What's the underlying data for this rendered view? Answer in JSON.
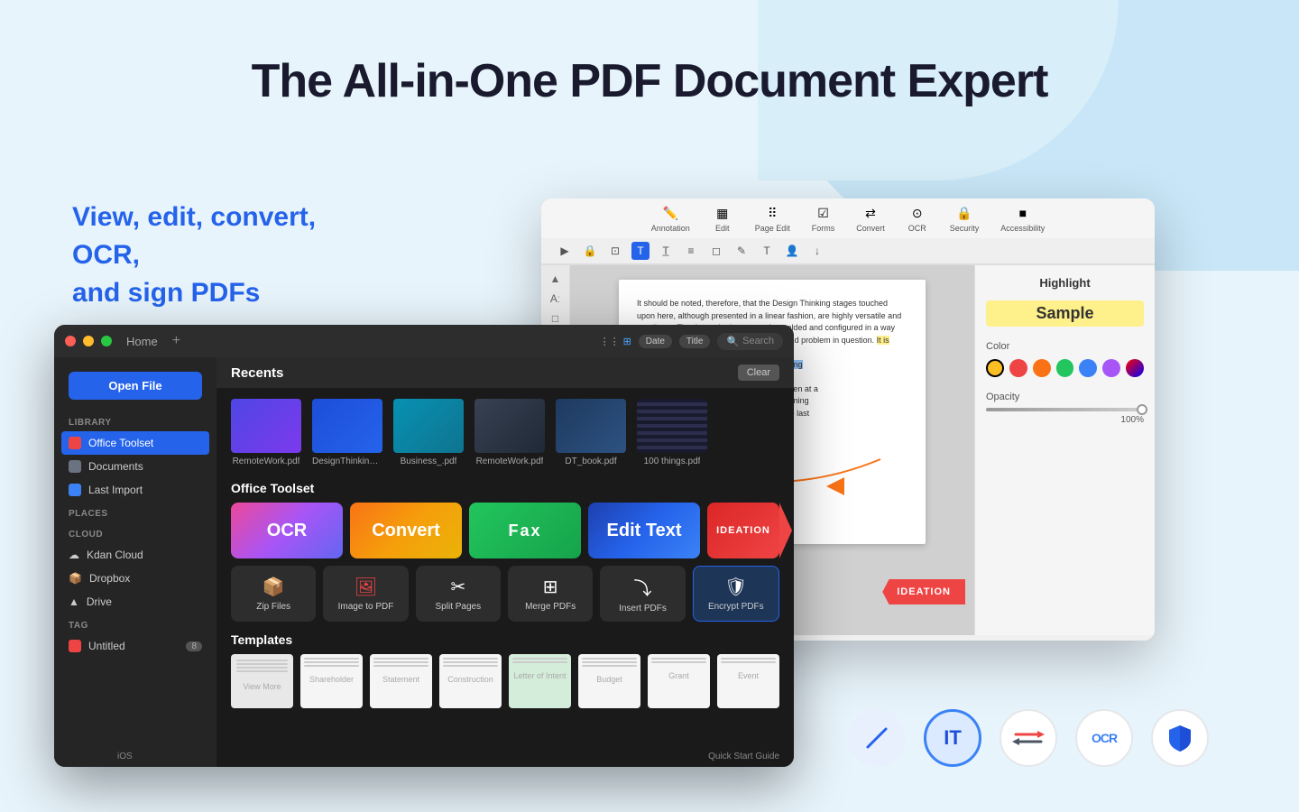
{
  "page": {
    "title": "The All-in-One PDF Document Expert",
    "subtitle": "View, edit, convert, OCR,\nand sign PDFs",
    "bg_color": "#e8f4fb"
  },
  "mac_window": {
    "title": "Home",
    "recents_label": "Recents",
    "clear_label": "Clear",
    "library_label": "LIBRARY",
    "places_label": "PLACES",
    "cloud_label": "CLOUD",
    "tag_label": "TAG",
    "open_file_label": "Open File",
    "sidebar_items": [
      {
        "label": "Office Toolset",
        "active": true
      },
      {
        "label": "Documents",
        "active": false
      },
      {
        "label": "Last Import",
        "active": false
      }
    ],
    "cloud_items": [
      {
        "label": "Kdan Cloud"
      },
      {
        "label": "Dropbox"
      },
      {
        "label": "Drive"
      }
    ],
    "tag_items": [
      {
        "label": "Untitled"
      }
    ],
    "recent_files": [
      {
        "name": "RemoteWork.pdf"
      },
      {
        "name": "DesignThinking.pdf"
      },
      {
        "name": "Business_.pdf"
      },
      {
        "name": "RemoteWork.pdf"
      },
      {
        "name": "DT_book.pdf"
      },
      {
        "name": "100 things.pdf"
      }
    ],
    "section_label": "Office Toolset",
    "feature_tiles": [
      {
        "label": "OCR",
        "style": "ocr"
      },
      {
        "label": "Convert",
        "style": "convert"
      },
      {
        "label": "Fax",
        "style": "fax"
      },
      {
        "label": "Edit Text",
        "style": "edittext"
      }
    ],
    "ideation_label": "IDEATION",
    "tools": [
      {
        "label": "Zip Files",
        "icon": "📦"
      },
      {
        "label": "Image to PDF",
        "icon": "🖼"
      },
      {
        "label": "Split Pages",
        "icon": "✂"
      },
      {
        "label": "Merge PDFs",
        "icon": "⊞"
      },
      {
        "label": "Insert PDFs",
        "icon": "⤵"
      },
      {
        "label": "Encrypt PDFs",
        "icon": "🛡"
      }
    ],
    "templates_label": "Templates",
    "template_items": [
      {
        "label": "View More"
      },
      {
        "label": "Shareholder"
      },
      {
        "label": "Statement"
      },
      {
        "label": "Construction"
      },
      {
        "label": "Letter of Intent"
      },
      {
        "label": "Budget"
      },
      {
        "label": "Grant"
      },
      {
        "label": "Event"
      }
    ],
    "ios_label": "iOS",
    "quick_start_label": "Quick Start Guide"
  },
  "pdf_window": {
    "toolbar_groups": [
      {
        "label": "Annotation",
        "icon": "✏"
      },
      {
        "label": "Edit",
        "icon": "▦"
      },
      {
        "label": "Page Edit",
        "icon": "⠿"
      },
      {
        "label": "Forms",
        "icon": "☑"
      },
      {
        "label": "Convert",
        "icon": "⇄"
      },
      {
        "label": "OCR",
        "icon": "⊙"
      },
      {
        "label": "Security",
        "icon": "🔒"
      },
      {
        "label": "Accessibility",
        "icon": "■"
      }
    ],
    "sub_tools": [
      "▶",
      "🔒",
      "⊡",
      "T",
      "T̲",
      "≡",
      "□",
      "✎",
      "T",
      "👤",
      "↓"
    ],
    "page_text": "It should be noted, therefore, that the Design Thinking stages touched upon here, although presented in a linear fashion, are highly versatile and non-linear. That is, such phases can be molded and configured in a way that conforms to the nature of the project and problem in question. It is possible, for instance, to start the Immersion phase and conduct Prototyping the context, or else, over the course of the ideation sessions don't need to be undertaken at a the process, but can permeate it from beginning a new project can start with Prototyping, the last in this book.",
    "right_panel": {
      "title": "Highlight",
      "sample_label": "Sample",
      "color_label": "Color",
      "colors": [
        "#fbbf24",
        "#ef4444",
        "#f97316",
        "#22c55e",
        "#3b82f6",
        "#a855f7"
      ],
      "opacity_label": "Opacity",
      "opacity_value": "100%"
    }
  },
  "bottom_icons": [
    {
      "label": "pen-icon",
      "symbol": "✏",
      "style": "pen"
    },
    {
      "label": "edit-text-icon",
      "symbol": "IT",
      "style": "edit"
    },
    {
      "label": "convert-icon",
      "symbol": "⇄",
      "style": "convert"
    },
    {
      "label": "ocr-icon",
      "symbol": "OCR",
      "style": "ocr"
    },
    {
      "label": "shield-icon",
      "symbol": "🛡",
      "style": "shield"
    }
  ]
}
